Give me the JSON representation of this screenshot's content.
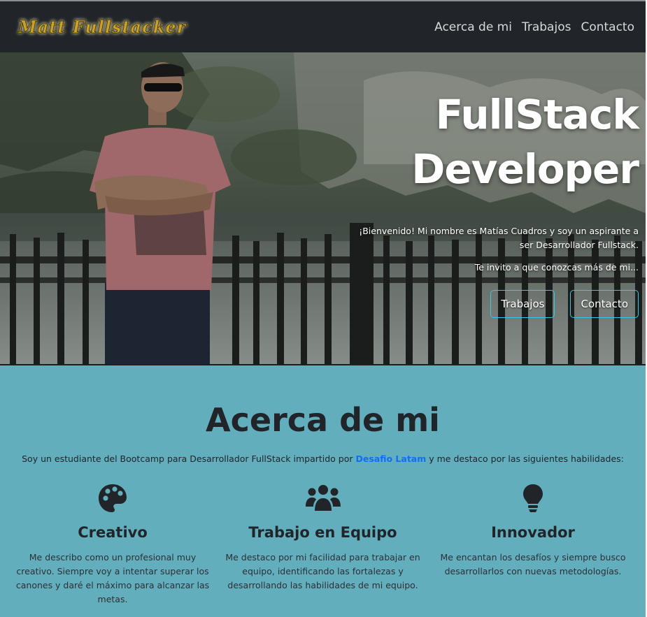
{
  "navbar": {
    "brand": "Matt Fullstacker",
    "links": [
      "Acerca de mi",
      "Trabajos",
      "Contacto"
    ]
  },
  "hero": {
    "title_line1": "FullStack",
    "title_line2": "Developer",
    "welcome": "¡Bienvenido! Mi nombre es Matías Cuadros y soy un aspirante a ser Desarrollador Fullstack.",
    "invite": "Te invito a que conozcas más de mi...",
    "buttons": [
      "Trabajos",
      "Contacto"
    ]
  },
  "about": {
    "title": "Acerca de mi",
    "intro_before": "Soy un estudiante del Bootcamp para Desarrollador FullStack impartido por ",
    "intro_link": "Desafio Latam",
    "intro_after": " y me destaco por las siguientes habilidades:",
    "skills": [
      {
        "icon": "palette-icon",
        "title": "Creativo",
        "text": "Me describo como un profesional muy creativo. Siempre voy a intentar superar los canones y daré el máximo para alcanzar las metas."
      },
      {
        "icon": "users-icon",
        "title": "Trabajo en Equipo",
        "text": "Me destaco por mi facilidad para trabajar en equipo, identificando las fortalezas y desarrollando las habilidades de mi equipo."
      },
      {
        "icon": "lightbulb-icon",
        "title": "Innovador",
        "text": "Me encantan los desafíos y siempre busco desarrollarlos con nuevas metodologías."
      }
    ]
  },
  "colors": {
    "navbar_bg": "#212529",
    "about_bg": "#63aebd",
    "accent_outline": "#3cc6e0",
    "link": "#0d6efd"
  }
}
